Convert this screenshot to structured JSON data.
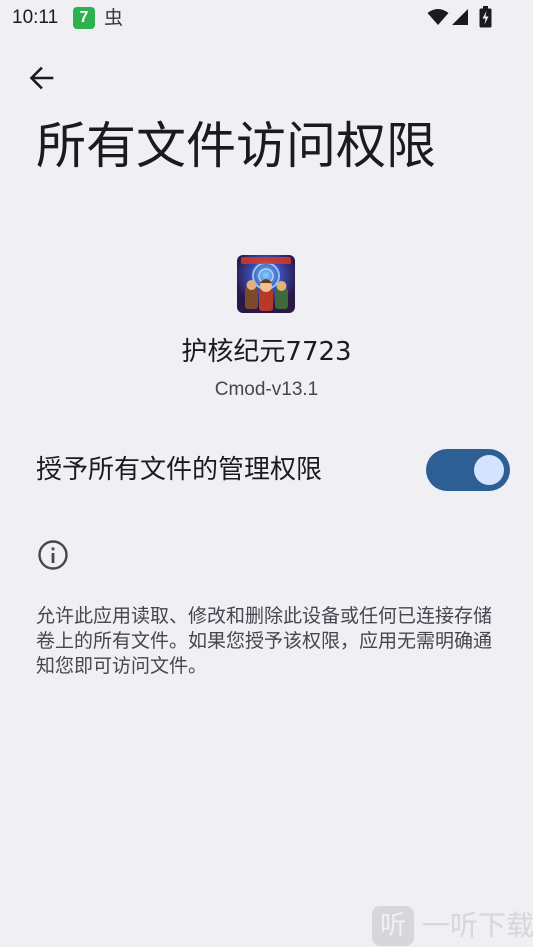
{
  "status_bar": {
    "time": "10:11",
    "app_badge": "7",
    "notification_glyph": "虫",
    "icons": [
      "wifi-icon",
      "signal-icon",
      "battery-charging-icon"
    ]
  },
  "header": {
    "back_icon": "arrow-left-icon",
    "title": "所有文件访问权限"
  },
  "app": {
    "name": "护核纪元7723",
    "version": "Cmod-v13.1"
  },
  "permission": {
    "label": "授予所有文件的管理权限",
    "enabled": true
  },
  "info": {
    "icon": "info-icon",
    "description": "允许此应用读取、修改和删除此设备或任何已连接存储卷上的所有文件。如果您授予该权限，应用无需明确通知您即可访问文件。"
  },
  "watermark": {
    "badge": "听",
    "text": "一听下载"
  },
  "colors": {
    "background": "#f0eff4",
    "toggle_track": "#2d5f95",
    "toggle_thumb": "#d4e3ff",
    "app_badge": "#2bb24c"
  }
}
